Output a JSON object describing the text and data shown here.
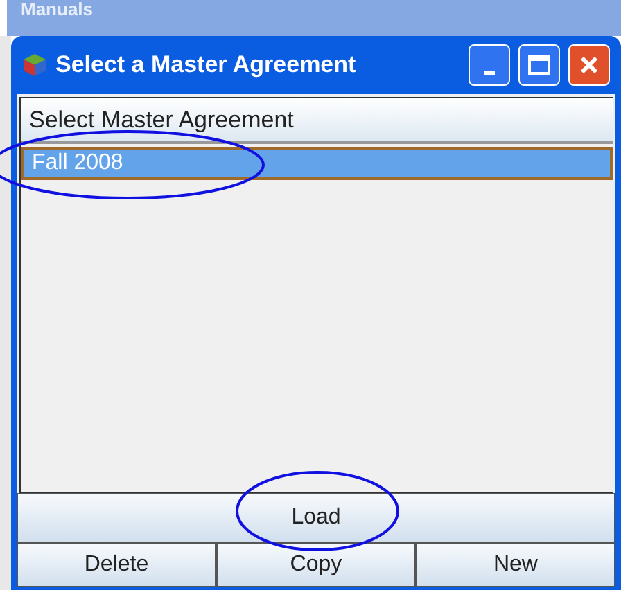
{
  "background_window": {
    "title": "Manuals"
  },
  "window": {
    "title": "Select a Master Agreement"
  },
  "list": {
    "header": "Select Master Agreement",
    "rows": [
      {
        "label": "Fall 2008",
        "selected": true
      }
    ]
  },
  "buttons": [
    {
      "label": "Load",
      "kind": "wide"
    },
    {
      "label": "Delete",
      "kind": "third"
    },
    {
      "label": "Copy",
      "kind": "third"
    },
    {
      "label": "New",
      "kind": "third"
    }
  ],
  "annotations": [
    {
      "kind": "ellipse"
    },
    {
      "kind": "ellipse"
    }
  ]
}
